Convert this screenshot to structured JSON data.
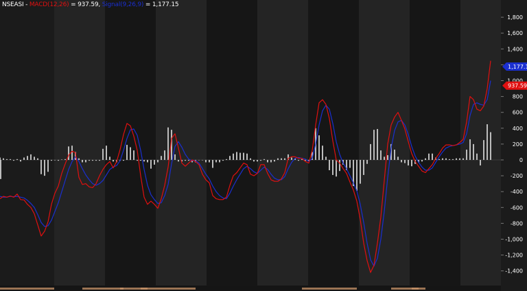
{
  "header": {
    "symbol": "NSEASI",
    "sep1": " - ",
    "macd_label": "MACD(12,26)",
    "eq1": " = ",
    "macd_value": "937.59",
    "sep2": ", ",
    "signal_label": "Signal(9,26,9)",
    "eq2": " = ",
    "signal_value": "1,177.15"
  },
  "colors": {
    "background": "#1b1b1b",
    "band_light": "#242424",
    "band_dark": "#161616",
    "macd_line": "#e01010",
    "signal_line": "#1a2fd0",
    "histogram": "#bdbdbd",
    "axis_text": "#ffffff",
    "bottom_strip": "#c8946a"
  },
  "chart_data": {
    "type": "line",
    "x": [
      0,
      5,
      10,
      15,
      20,
      25,
      30,
      35,
      40,
      45,
      50,
      55,
      60,
      65,
      70,
      75,
      80,
      85,
      90,
      95,
      100,
      105,
      110,
      115,
      120,
      125,
      130,
      135,
      140,
      145,
      150,
      155,
      160,
      165,
      170,
      175,
      180,
      185,
      190,
      195,
      200,
      205,
      210,
      215,
      220,
      225,
      230,
      235,
      240,
      245,
      250,
      255,
      260,
      265,
      270,
      275,
      280,
      285,
      290,
      295,
      300,
      305,
      310,
      315,
      320,
      325,
      330,
      335,
      340,
      345,
      350,
      355,
      360,
      365,
      370,
      375,
      380,
      385,
      390,
      395,
      400,
      405,
      410,
      415,
      420,
      425,
      430,
      435,
      440,
      445,
      450,
      455,
      460,
      465,
      470,
      475,
      480,
      485,
      490,
      495,
      500,
      505,
      510,
      515,
      520,
      525,
      530,
      535,
      540,
      545,
      550,
      555,
      560,
      565,
      570,
      575,
      580,
      585,
      590,
      595,
      600,
      605,
      610,
      615,
      620,
      625,
      630,
      635,
      640,
      645,
      650,
      655,
      660,
      665,
      670,
      675,
      680,
      685,
      690,
      695,
      700,
      705,
      710,
      715
    ],
    "series": [
      {
        "name": "MACD(12,26)",
        "values": [
          -490,
          -460,
          -470,
          -455,
          -470,
          -430,
          -500,
          -505,
          -560,
          -600,
          -680,
          -820,
          -960,
          -900,
          -780,
          -560,
          -420,
          -330,
          -170,
          -50,
          60,
          110,
          90,
          -220,
          -310,
          -300,
          -340,
          -350,
          -300,
          -200,
          -120,
          -60,
          -20,
          -100,
          -20,
          130,
          320,
          460,
          430,
          300,
          120,
          -200,
          -470,
          -560,
          -520,
          -560,
          -610,
          -490,
          -320,
          -90,
          270,
          330,
          150,
          -40,
          -80,
          -40,
          0,
          -20,
          -60,
          -180,
          -250,
          -290,
          -450,
          -490,
          -500,
          -500,
          -470,
          -320,
          -200,
          -160,
          -100,
          -40,
          -60,
          -180,
          -200,
          -170,
          -60,
          -60,
          -170,
          -250,
          -270,
          -270,
          -240,
          -160,
          20,
          40,
          40,
          20,
          20,
          -20,
          -40,
          120,
          440,
          720,
          760,
          700,
          520,
          240,
          0,
          -40,
          -110,
          -170,
          -280,
          -380,
          -520,
          -750,
          -1050,
          -1270,
          -1420,
          -1330,
          -1050,
          -720,
          -260,
          200,
          440,
          540,
          600,
          500,
          390,
          230,
          80,
          -20,
          -80,
          -140,
          -160,
          -110,
          -60,
          20,
          80,
          150,
          190,
          190,
          180,
          190,
          220,
          260,
          480,
          800,
          760,
          640,
          620,
          680,
          900,
          1250,
          1780,
          1740,
          1350,
          937.59
        ],
        "color": "#e01010"
      },
      {
        "name": "Signal(9,26,9)",
        "values": [
          -460,
          -470,
          -470,
          -460,
          -465,
          -460,
          -470,
          -480,
          -510,
          -550,
          -600,
          -690,
          -790,
          -840,
          -830,
          -760,
          -650,
          -540,
          -400,
          -260,
          -120,
          -20,
          40,
          -20,
          -110,
          -190,
          -250,
          -300,
          -320,
          -300,
          -260,
          -190,
          -120,
          -90,
          -70,
          -10,
          120,
          270,
          380,
          390,
          310,
          120,
          -120,
          -320,
          -440,
          -500,
          -550,
          -540,
          -450,
          -310,
          -50,
          170,
          230,
          160,
          70,
          10,
          -10,
          -10,
          -40,
          -110,
          -180,
          -240,
          -330,
          -400,
          -450,
          -480,
          -490,
          -420,
          -330,
          -250,
          -180,
          -110,
          -80,
          -110,
          -150,
          -170,
          -130,
          -90,
          -120,
          -180,
          -230,
          -250,
          -250,
          -210,
          -110,
          -30,
          20,
          30,
          20,
          10,
          -20,
          20,
          200,
          440,
          620,
          690,
          640,
          460,
          230,
          70,
          -40,
          -110,
          -200,
          -290,
          -390,
          -560,
          -790,
          -1050,
          -1260,
          -1340,
          -1240,
          -1000,
          -650,
          -220,
          150,
          370,
          480,
          500,
          440,
          320,
          170,
          50,
          -30,
          -90,
          -130,
          -130,
          -100,
          -30,
          40,
          100,
          150,
          170,
          180,
          190,
          200,
          220,
          330,
          560,
          700,
          720,
          700,
          690,
          760,
          1000,
          1400,
          1580,
          1450,
          1177.15
        ],
        "color": "#1a2fd0"
      },
      {
        "name": "Histogram",
        "values": [
          30,
          20,
          10,
          10,
          -10,
          10,
          -20,
          30,
          50,
          70,
          40,
          20,
          -180,
          -200,
          -150,
          -10,
          -5,
          -10,
          5,
          10,
          170,
          180,
          100,
          20,
          -30,
          -30,
          -10,
          -10,
          -10,
          -10,
          140,
          180,
          40,
          -20,
          -30,
          -10,
          -10,
          190,
          160,
          120,
          -10,
          -10,
          -20,
          -30,
          -110,
          -60,
          -30,
          50,
          120,
          410,
          380,
          70,
          -20,
          -20,
          -10,
          -10,
          -30,
          -30,
          0,
          0,
          -30,
          -30,
          -100,
          -30,
          -30,
          -10,
          10,
          50,
          80,
          100,
          90,
          90,
          80,
          20,
          -20,
          -20,
          -10,
          10,
          -30,
          -30,
          -20,
          20,
          20,
          20,
          70,
          30,
          20,
          -10,
          10,
          -10,
          -10,
          100,
          400,
          310,
          180,
          40,
          -130,
          -190,
          -210,
          -140,
          -60,
          -130,
          -100,
          -330,
          -390,
          -300,
          -190,
          -50,
          200,
          380,
          390,
          120,
          40,
          60,
          200,
          130,
          40,
          -30,
          -40,
          -70,
          -80,
          -50,
          -30,
          -20,
          20,
          80,
          80,
          30,
          10,
          20,
          20,
          10,
          10,
          20,
          20,
          20,
          130,
          260,
          200,
          80,
          -70,
          250,
          450,
          350,
          -60,
          -240,
          -140,
          -240
        ],
        "color": "#bdbdbd"
      }
    ],
    "xlabel": "",
    "ylabel": "",
    "ylim": [
      -1520,
      2010
    ],
    "y_ticks": [
      1800,
      1600,
      1400,
      1200,
      1000,
      800,
      600,
      400,
      200,
      0,
      -200,
      -400,
      -600,
      -800,
      -1000,
      -1200,
      -1400
    ],
    "y_tick_labels": [
      "1,800",
      "1,600",
      "1,400",
      "1,200",
      "1,000",
      "800",
      "600",
      "400",
      "200",
      "0",
      "-200",
      "-400",
      "-600",
      "-800",
      "-1,000",
      "-1,200",
      "-1,400"
    ],
    "last_value_tags": [
      {
        "label": "1,177.15",
        "value": 1177.15,
        "color": "#1a2fd0"
      },
      {
        "label": "937.59",
        "value": 937.59,
        "color": "#e01010"
      }
    ],
    "grid": false,
    "legend": "top-left"
  }
}
